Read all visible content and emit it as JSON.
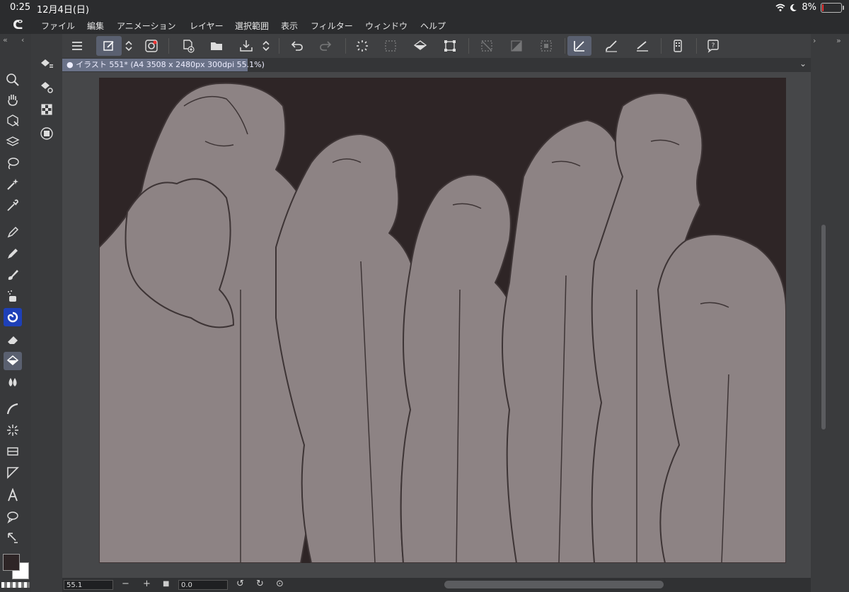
{
  "status": {
    "time": "0:25",
    "date": "12月4日(日)",
    "battery": "8%",
    "battery_level": 0.08
  },
  "menu": {
    "logo": "ᕦ",
    "items": [
      "ファイル",
      "編集",
      "アニメーション",
      "レイヤー",
      "選択範囲",
      "表示",
      "フィルター",
      "ウィンドウ",
      "ヘルプ"
    ]
  },
  "document": {
    "tab_title": "イラスト 551* (A4 3508 x 2480px 300dpi 55.1%)"
  },
  "bottom": {
    "zoom": "55.1",
    "rotation": "0.0"
  },
  "colors": {
    "accent": "#5a6070",
    "canvas": "#8d8384",
    "artboard_bg": "#2e2526",
    "line": "#3d3435"
  },
  "icons": {
    "toolbar": [
      "menu-icon",
      "new-layer-icon",
      "stepper-icon",
      "cs-logo-icon",
      "new-file-icon",
      "open-folder-icon",
      "save-icon",
      "stepper-icon",
      "undo-icon",
      "redo-icon",
      "loading-icon",
      "select-dots-icon",
      "fill-icon",
      "transform-icon",
      "deselect-icon",
      "invert-icon",
      "select-frame-icon",
      "snap-ruler-icon",
      "brush-snap-icon",
      "line-snap-icon",
      "device-icon",
      "help-icon"
    ],
    "tools": [
      "zoom-icon",
      "hand-icon",
      "object-icon",
      "layer-move-icon",
      "lasso-icon",
      "wand-icon",
      "eyedropper-icon",
      "pen-icon",
      "pencil-icon",
      "brush-icon",
      "airbrush-icon",
      "decoration-icon",
      "eraser-icon",
      "fill-bucket-icon",
      "blend-icon",
      "figure-icon",
      "frame-icon",
      "gradient-icon",
      "ruler-icon",
      "text-icon",
      "balloon-icon",
      "correct-line-icon"
    ],
    "subtools": [
      "fill-subtool-icon",
      "fill-settings-icon",
      "checker-icon",
      "layer-box-icon"
    ]
  }
}
